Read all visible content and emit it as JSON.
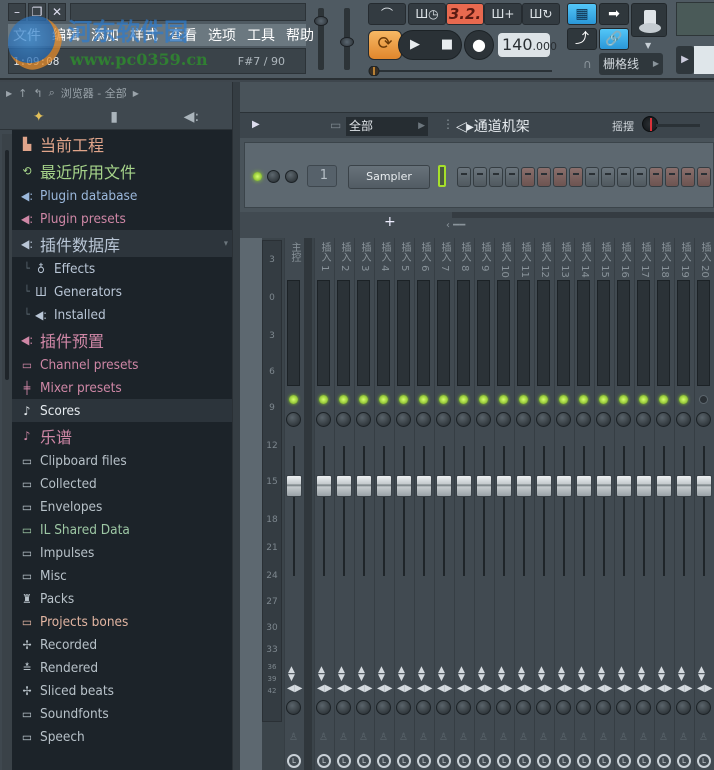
{
  "window": {
    "controls": [
      "minimize",
      "restore",
      "close"
    ],
    "menu": [
      "文件",
      "编辑",
      "添加",
      "样式",
      "查看",
      "选项",
      "工具",
      "帮助"
    ],
    "time": "1:09:08",
    "pitch_info": "F#7 / 90",
    "watermark": {
      "title": "河东软件园",
      "url": "www.pc0359.cn"
    }
  },
  "transport": {
    "pattern_mode_icon": "metronome-icon",
    "tempo_tap_icon": "tap-tempo-icon",
    "countdown_value": "3.2.",
    "step_add_icon": "step-add-icon",
    "loop_record_icon": "loop-record-icon",
    "loop_icon": "loop-icon",
    "play_icon": "play-icon",
    "stop_icon": "stop-icon",
    "record_icon": "record-icon",
    "tempo_int": "140",
    "tempo_dec": ".000"
  },
  "tools": {
    "piano_roll_icon": "piano-roll-icon",
    "arrow_icon": "arrow-right-icon",
    "knob_icon": "master-knob-icon",
    "brush_icon": "brush-icon",
    "link_icon": "link-icon",
    "snap_label": "栅格线",
    "magnet_icon": "magnet-icon"
  },
  "browser": {
    "header": "浏览器 - 全部",
    "tabs": [
      "waveform-tab",
      "file-tab",
      "plugin-tab"
    ],
    "items": [
      {
        "label": "当前工程",
        "icon": "project-icon",
        "color": "orange",
        "size": "big"
      },
      {
        "label": "最近所用文件",
        "icon": "recent-folder-icon",
        "color": "green",
        "size": "big"
      },
      {
        "label": "Plugin database",
        "icon": "plugin-icon",
        "color": "blue",
        "size": "normal"
      },
      {
        "label": "Plugin presets",
        "icon": "plugin-icon",
        "color": "pink",
        "size": "normal"
      },
      {
        "label": "插件数据库",
        "icon": "plugin-icon",
        "color": "lblue",
        "size": "big",
        "selected": true
      },
      {
        "label": "Effects",
        "icon": "effect-icon",
        "color": "lblue",
        "size": "sub"
      },
      {
        "label": "Generators",
        "icon": "generator-icon",
        "color": "lblue",
        "size": "sub"
      },
      {
        "label": "Installed",
        "icon": "plugin-icon",
        "color": "lblue",
        "size": "sub"
      },
      {
        "label": "插件预置",
        "icon": "plugin-icon",
        "color": "pink",
        "size": "big"
      },
      {
        "label": "Channel presets",
        "icon": "channel-icon",
        "color": "pink",
        "size": "normal"
      },
      {
        "label": "Mixer presets",
        "icon": "mixer-icon",
        "color": "pink",
        "size": "normal"
      },
      {
        "label": "Scores",
        "icon": "note-icon",
        "color": "white",
        "size": "normal",
        "highlight": true
      },
      {
        "label": "乐谱",
        "icon": "note-icon",
        "color": "pink",
        "size": "big"
      },
      {
        "label": "Clipboard files",
        "icon": "folder-icon",
        "color": "grey",
        "size": "normal"
      },
      {
        "label": "Collected",
        "icon": "folder-icon",
        "color": "grey",
        "size": "normal"
      },
      {
        "label": "Envelopes",
        "icon": "folder-icon",
        "color": "grey",
        "size": "normal"
      },
      {
        "label": "IL Shared Data",
        "icon": "shared-folder-icon",
        "color": "green2",
        "size": "normal"
      },
      {
        "label": "Impulses",
        "icon": "folder-icon",
        "color": "grey",
        "size": "normal"
      },
      {
        "label": "Misc",
        "icon": "folder-icon",
        "color": "grey",
        "size": "normal"
      },
      {
        "label": "Packs",
        "icon": "packs-icon",
        "color": "grey",
        "size": "normal"
      },
      {
        "label": "Projects bones",
        "icon": "folder-icon",
        "color": "peach",
        "size": "normal"
      },
      {
        "label": "Recorded",
        "icon": "waveform-icon",
        "color": "grey",
        "size": "normal"
      },
      {
        "label": "Rendered",
        "icon": "render-icon",
        "color": "grey",
        "size": "normal"
      },
      {
        "label": "Sliced beats",
        "icon": "waveform-icon",
        "color": "grey",
        "size": "normal"
      },
      {
        "label": "Soundfonts",
        "icon": "folder-icon",
        "color": "grey",
        "size": "normal"
      },
      {
        "label": "Speech",
        "icon": "folder-icon",
        "color": "grey",
        "size": "normal"
      }
    ]
  },
  "channel_rack": {
    "filter": "全部",
    "title": "通道机架",
    "swing_label": "摇摆",
    "channel": {
      "number": "1",
      "name": "Sampler",
      "steps": [
        "grey",
        "grey",
        "grey",
        "grey",
        "red",
        "red",
        "red",
        "red",
        "grey",
        "grey",
        "grey",
        "grey",
        "red",
        "red",
        "red",
        "red"
      ]
    },
    "add_label": "+"
  },
  "mixer": {
    "db_scale": [
      "3",
      "0",
      "3",
      "6",
      "9",
      "12",
      "15",
      "18",
      "21",
      "24",
      "27",
      "30",
      "33",
      "36",
      "39",
      "42"
    ],
    "tracks": [
      {
        "label": "主控",
        "active": true
      },
      {
        "label": "插入 1",
        "active": true
      },
      {
        "label": "插入 2",
        "active": true
      },
      {
        "label": "插入 3",
        "active": true
      },
      {
        "label": "插入 4",
        "active": true
      },
      {
        "label": "插入 5",
        "active": true
      },
      {
        "label": "插入 6",
        "active": true
      },
      {
        "label": "插入 7",
        "active": true
      },
      {
        "label": "插入 8",
        "active": true
      },
      {
        "label": "插入 9",
        "active": true
      },
      {
        "label": "插入 10",
        "active": true
      },
      {
        "label": "插入 11",
        "active": true
      },
      {
        "label": "插入 12",
        "active": true
      },
      {
        "label": "插入 13",
        "active": true
      },
      {
        "label": "插入 14",
        "active": true
      },
      {
        "label": "插入 15",
        "active": true
      },
      {
        "label": "插入 16",
        "active": true
      },
      {
        "label": "插入 17",
        "active": true
      },
      {
        "label": "插入 18",
        "active": true
      },
      {
        "label": "插入 19",
        "active": true
      },
      {
        "label": "插入 20",
        "active": false
      }
    ]
  }
}
